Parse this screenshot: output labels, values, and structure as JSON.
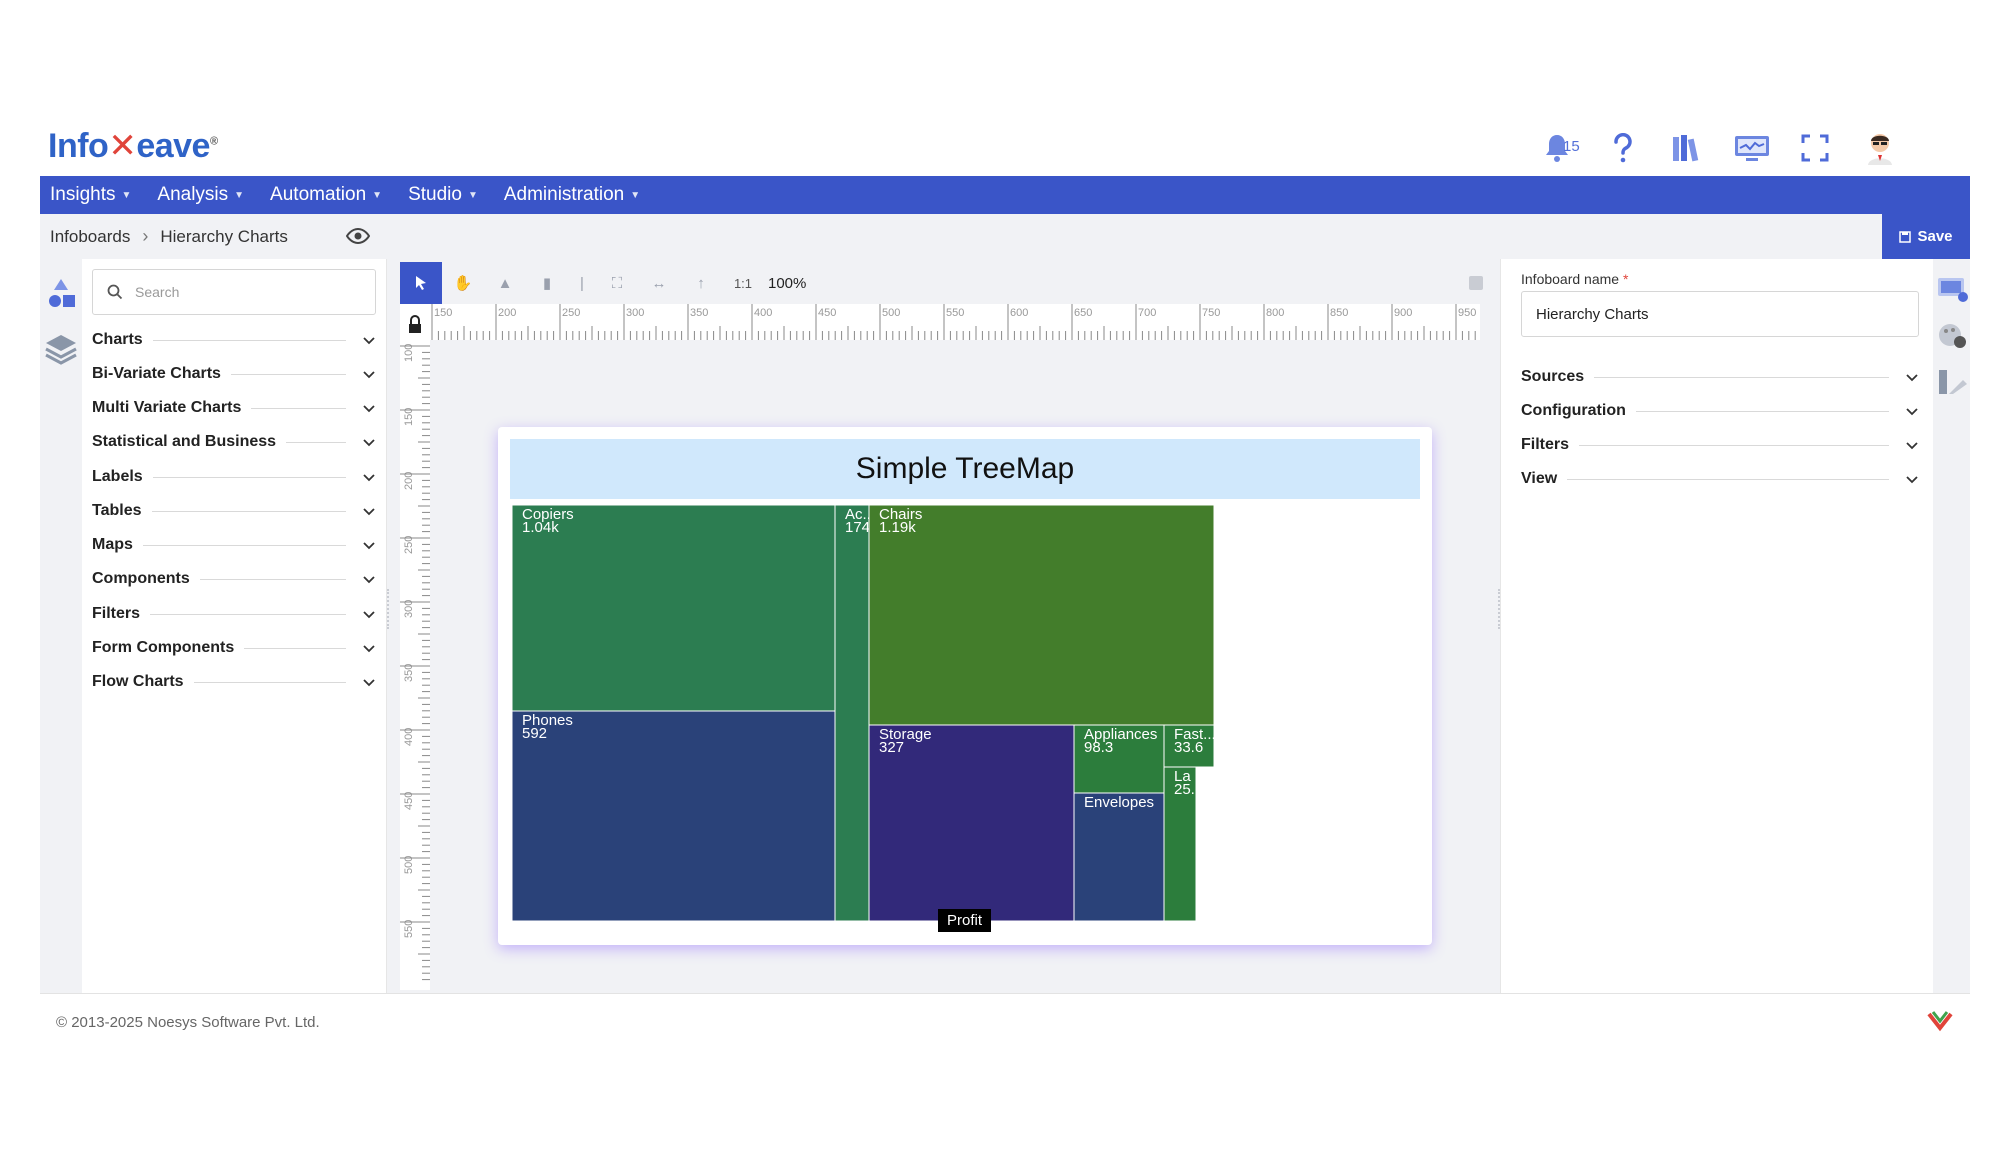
{
  "brand": {
    "logo_text_a": "Info",
    "logo_text_b": "eave",
    "logo_reg": "®"
  },
  "header": {
    "notifications_count": "15"
  },
  "nav": {
    "items": [
      "Insights",
      "Analysis",
      "Automation",
      "Studio",
      "Administration"
    ]
  },
  "breadcrumb": {
    "root": "Infoboards",
    "current": "Hierarchy Charts"
  },
  "actions": {
    "save_label": "Save"
  },
  "left_panel": {
    "search_placeholder": "Search",
    "categories": [
      "Charts",
      "Bi-Variate Charts",
      "Multi Variate Charts",
      "Statistical and Business",
      "Labels",
      "Tables",
      "Maps",
      "Components",
      "Filters",
      "Form Components",
      "Flow Charts"
    ]
  },
  "toolbar": {
    "zoom_ratio_label": "1:1",
    "zoom_level": "100%"
  },
  "rulers": {
    "horizontal": [
      "150",
      "200",
      "250",
      "300",
      "350",
      "400",
      "450",
      "500",
      "550",
      "600",
      "650",
      "700",
      "750",
      "800",
      "850",
      "900",
      "950"
    ],
    "vertical": [
      "100",
      "150",
      "200",
      "250",
      "300",
      "350",
      "400",
      "450",
      "500",
      "550"
    ]
  },
  "chart_data": {
    "type": "treemap",
    "title": "Simple TreeMap",
    "tiles": [
      {
        "name": "Copiers",
        "value_label": "1.04k",
        "color": "#2c7d51"
      },
      {
        "name": "Ac...",
        "value_label": "174",
        "color": "#2c7d51"
      },
      {
        "name": "Chairs",
        "value_label": "1.19k",
        "color": "#437d2b"
      },
      {
        "name": "Phones",
        "value_label": "592",
        "color": "#2a4279"
      },
      {
        "name": "Storage",
        "value_label": "327",
        "color": "#32297a"
      },
      {
        "name": "Appliances",
        "value_label": "98.3",
        "color": "#2c7d3c"
      },
      {
        "name": "Fast...",
        "value_label": "33.6",
        "color": "#2c7d3c"
      },
      {
        "name": "La",
        "value_label": "25.",
        "color": "#2c7d3c"
      },
      {
        "name": "Envelopes",
        "value_label": "",
        "color": "#2a4279"
      }
    ],
    "tooltip": "Profit"
  },
  "right_panel": {
    "infoboard_name_label": "Infoboard name",
    "required_mark": "*",
    "infoboard_name_value": "Hierarchy Charts",
    "sections": [
      "Sources",
      "Configuration",
      "Filters",
      "View"
    ]
  },
  "footer": {
    "copyright": "© 2013-2025 Noesys Software Pvt. Ltd."
  },
  "colors": {
    "primary": "#3a55c8",
    "panel_bg": "#f1f2f5"
  }
}
